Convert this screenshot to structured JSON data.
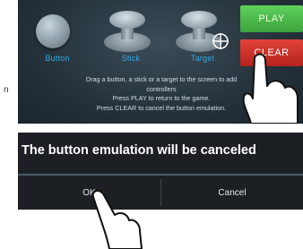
{
  "controls": [
    {
      "label": "Button"
    },
    {
      "label": "Stick"
    },
    {
      "label": "Target"
    }
  ],
  "actions": {
    "play_label": "PLAY",
    "clear_label": "CLEAR"
  },
  "instructions": [
    "Drag a button, a stick or a target to the screen to add",
    "controllers",
    "Press PLAY to return to the game.",
    "Press CLEAR to cancel the button emulation."
  ],
  "side_letter": "n",
  "dialog": {
    "message": "The button emulation will be canceled",
    "ok_label": "OK",
    "cancel_label": "Cancel"
  },
  "colors": {
    "panel_bg": "#25323b",
    "control_label": "#36a7e0",
    "play": "#4bb84a",
    "clear": "#d1322b",
    "dialog_bg": "#1c2024"
  },
  "icons": [
    "hand-pointer-icon",
    "crosshair-icon"
  ]
}
